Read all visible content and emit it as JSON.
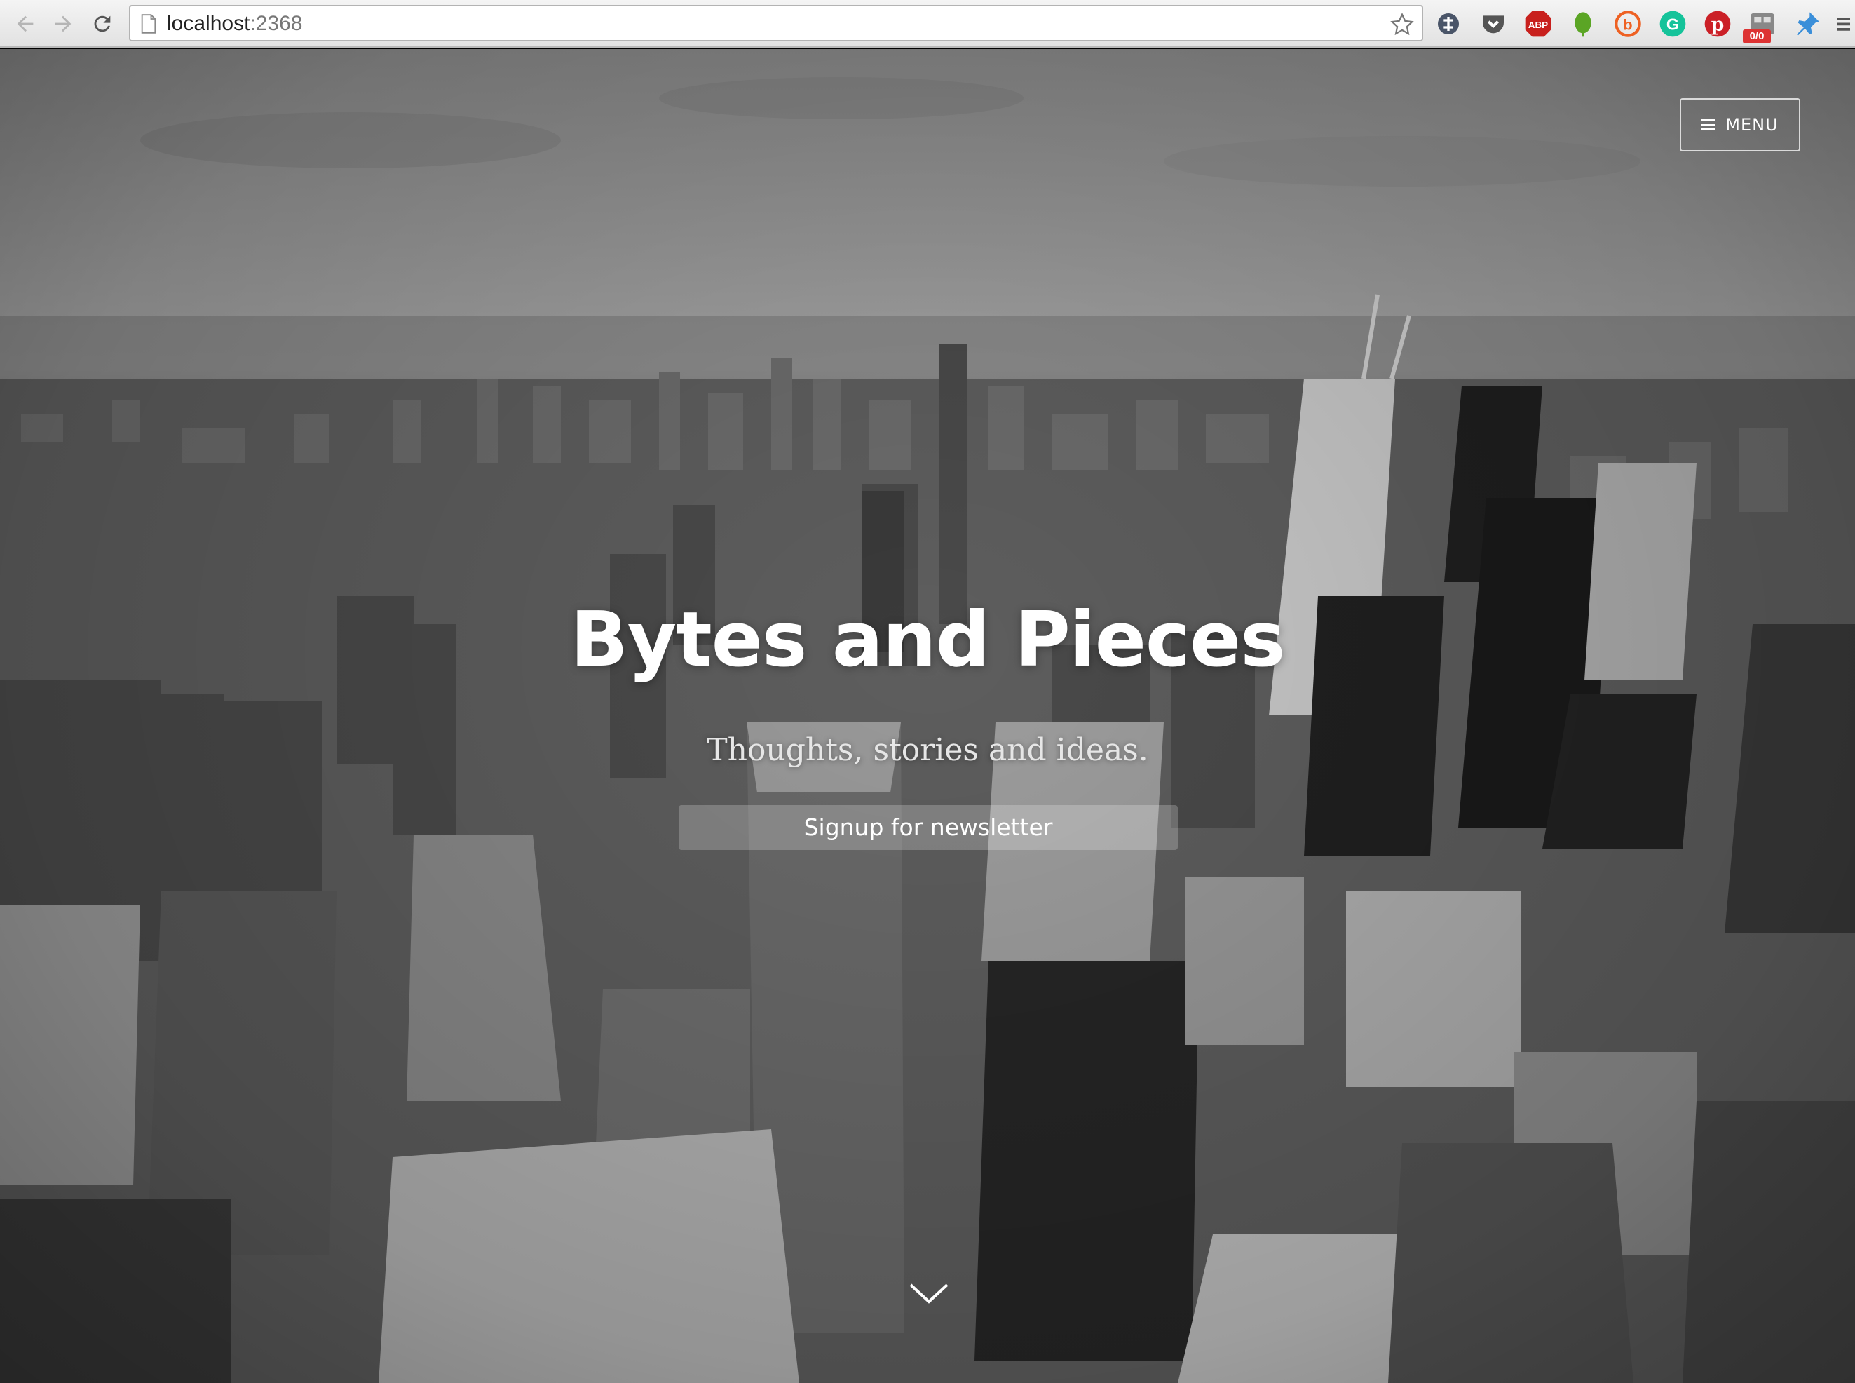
{
  "browser": {
    "url_host": "localhost",
    "url_port": ":2368",
    "badge_text": "0/0",
    "extensions": [
      "sync-icon",
      "pocket-icon",
      "adblock-icon",
      "evernote-icon",
      "bitly-icon",
      "grammarly-icon",
      "pinterest-icon",
      "tab-counter-icon",
      "pin-icon",
      "chrome-menu-icon"
    ]
  },
  "hero": {
    "menu_label": "MENU",
    "title": "Bytes and Pieces",
    "description": "Thoughts, stories and ideas.",
    "signup_label": "Signup for newsletter"
  },
  "colors": {
    "title": "#ffffff",
    "button_overlay": "rgba(255,255,255,0.22)"
  }
}
